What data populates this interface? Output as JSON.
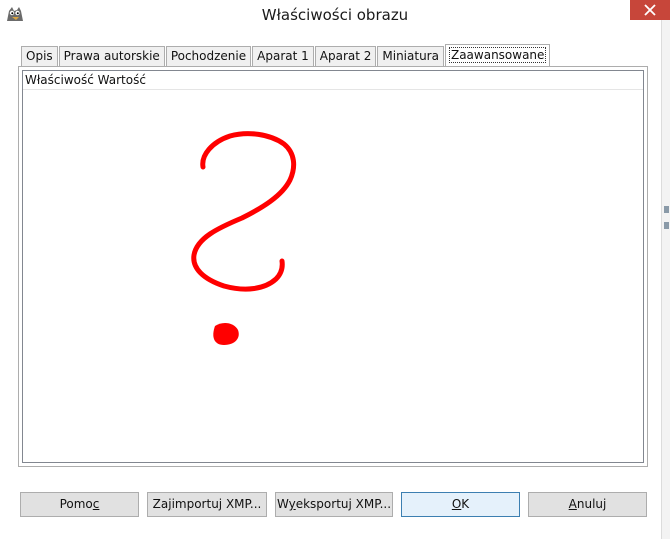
{
  "window": {
    "title": "Właściwości obrazu",
    "app_icon": "gimp-wilber-icon"
  },
  "tabs": [
    {
      "label": "Opis",
      "active": false
    },
    {
      "label": "Prawa autorskie",
      "active": false
    },
    {
      "label": "Pochodzenie",
      "active": false
    },
    {
      "label": "Aparat 1",
      "active": false
    },
    {
      "label": "Aparat 2",
      "active": false
    },
    {
      "label": "Miniatura",
      "active": false
    },
    {
      "label": "Zaawansowane",
      "active": true
    }
  ],
  "table": {
    "header": "Właściwość Wartość",
    "rows": []
  },
  "overlay": {
    "description_icon": "red-hand-drawn-question-mark",
    "color": "#ff0000"
  },
  "buttons": {
    "help": {
      "pre": "Pomo",
      "accel": "c",
      "post": ""
    },
    "import_xmp": {
      "pre": "Za",
      "accel": "j",
      "post": "importuj XMP..."
    },
    "export_xmp": {
      "pre": "W",
      "accel": "y",
      "post": "eksportuj XMP..."
    },
    "ok": {
      "pre": "",
      "accel": "O",
      "post": "K"
    },
    "cancel": {
      "pre": "",
      "accel": "A",
      "post": "nuluj"
    }
  },
  "colors": {
    "close_button": "#c7463a",
    "default_button_border": "#3c7fb1"
  }
}
